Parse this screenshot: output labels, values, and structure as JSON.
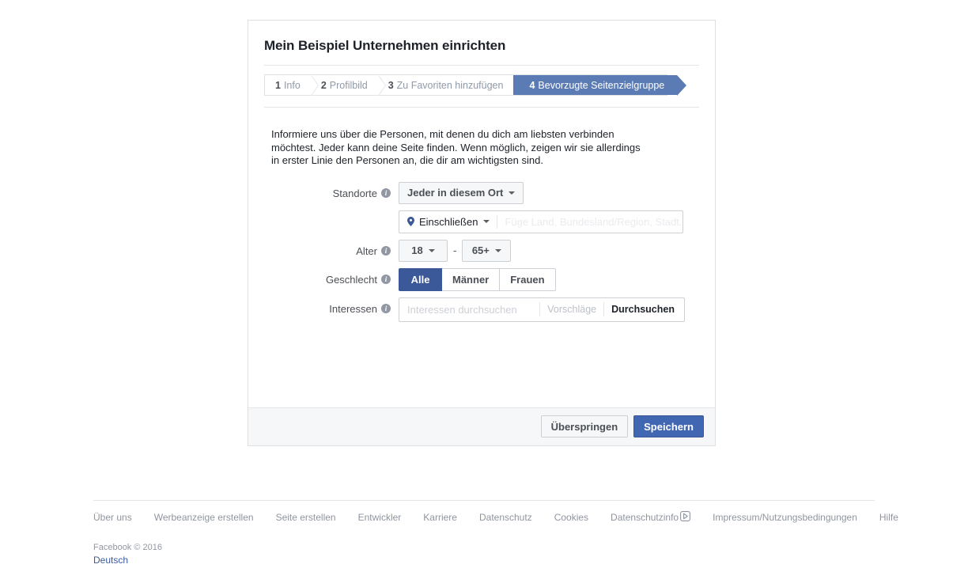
{
  "card": {
    "title": "Mein Beispiel Unternehmen einrichten",
    "steps": [
      {
        "num": "1",
        "label": "Info"
      },
      {
        "num": "2",
        "label": "Profilbild"
      },
      {
        "num": "3",
        "label": "Zu Favoriten hinzufügen"
      },
      {
        "num": "4",
        "label": "Bevorzugte Seitenzielgruppe"
      }
    ],
    "intro": "Informiere uns über die Personen, mit denen du dich am liebsten verbinden möchtest. Jeder kann deine Seite finden. Wenn möglich, zeigen wir sie allerdings in erster Linie den Personen an, die dir am wichtigsten sind.",
    "form": {
      "locations": {
        "label": "Standorte",
        "dropdown_value": "Jeder in diesem Ort",
        "include_label": "Einschließen",
        "place_placeholder": "Füge Land, Bundesland/Region, Stadt.."
      },
      "age": {
        "label": "Alter",
        "min": "18",
        "separator": "-",
        "max": "65+"
      },
      "gender": {
        "label": "Geschlecht",
        "options": [
          "Alle",
          "Männer",
          "Frauen"
        ],
        "selected": "Alle"
      },
      "interests": {
        "label": "Interessen",
        "placeholder": "Interessen durchsuchen",
        "tab_suggestions": "Vorschläge",
        "tab_search": "Durchsuchen"
      }
    },
    "footer": {
      "skip_label": "Überspringen",
      "save_label": "Speichern"
    }
  },
  "page_footer": {
    "links": [
      "Über uns",
      "Werbeanzeige erstellen",
      "Seite erstellen",
      "Entwickler",
      "Karriere",
      "Datenschutz",
      "Cookies"
    ],
    "adchoices_label": "Datenschutzinfo",
    "links_after": [
      "Impressum/Nutzungsbedingungen",
      "Hilfe"
    ],
    "copyright": "Facebook © 2016",
    "language": "Deutsch"
  },
  "colors": {
    "brand_blue": "#3b5998",
    "button_blue": "#4267b2",
    "active_step_blue": "#5b7bb5",
    "border_grey": "#ccd0d5",
    "bg_grey": "#f6f7f8"
  }
}
